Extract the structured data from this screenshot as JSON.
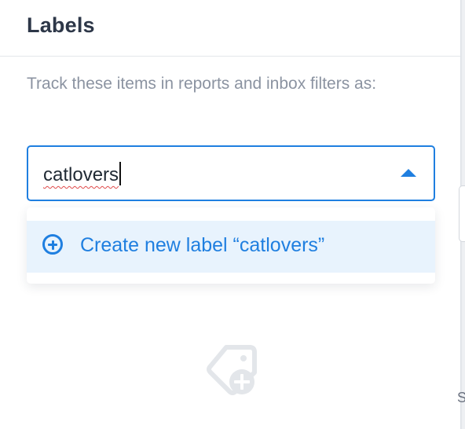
{
  "panel": {
    "title": "Labels",
    "description": "Track these items in reports and inbox filters as:"
  },
  "label_input": {
    "value": "catlovers",
    "expanded": true
  },
  "dropdown": {
    "options": [
      {
        "icon": "plus-circle-icon",
        "label": "Create new label “catlovers”",
        "highlighted": true
      }
    ]
  },
  "background_edge_text": "S",
  "colors": {
    "accent": "#1f7fe0",
    "title": "#2d3748",
    "muted_text": "#8b93a1",
    "option_highlight": "#e8f3fd",
    "empty_state_icon": "#e3e6ea"
  },
  "empty_state": {
    "icon": "tag-add-icon"
  }
}
